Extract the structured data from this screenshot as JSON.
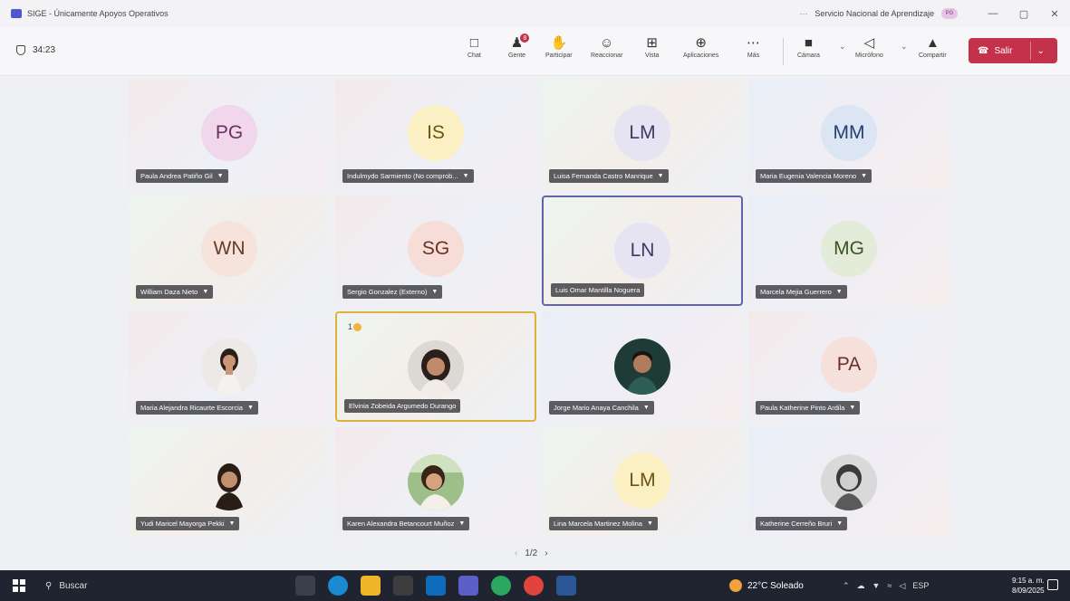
{
  "window": {
    "title": "SIGE - Únicamente Apoyos Operativos",
    "more": "···",
    "org_name": "Servicio Nacional de Aprendizaje",
    "org_badge": "PG",
    "minimize": "—",
    "maximize": "▢",
    "close": "✕"
  },
  "meeting": {
    "timer": "34:23"
  },
  "toolbar": {
    "chat": "Chat",
    "people": "Gente",
    "people_badge": "8",
    "raise": "Participar",
    "react": "Reaccionar",
    "view": "Vista",
    "apps": "Aplicaciones",
    "more": "Más",
    "camera": "Cámara",
    "mic": "Micrófono",
    "share": "Compartir",
    "leave": "Salir"
  },
  "participants": [
    {
      "initials": "PG",
      "name": "Paula Andrea Patiño Gil",
      "avatar_color": "#f1d7ec",
      "text_color": "#6b2f66"
    },
    {
      "initials": "IS",
      "name": "Indulmydo Sarmiento (No comprob...",
      "avatar_color": "#fbf0c4",
      "text_color": "#6a5410"
    },
    {
      "initials": "LM",
      "name": "Luisa Fernanda Castro Manrique",
      "avatar_color": "#e6e3f3",
      "text_color": "#3e3a66"
    },
    {
      "initials": "MM",
      "name": "Maria Eugenia Valencia Moreno",
      "avatar_color": "#dbe5f4",
      "text_color": "#24406b"
    },
    {
      "initials": "WN",
      "name": "William Daza Nieto",
      "avatar_color": "#f6e4dc",
      "text_color": "#6a3a22"
    },
    {
      "initials": "SG",
      "name": "Sergio Gonzalez (Externo)",
      "avatar_color": "#f7ddd8",
      "text_color": "#6e2f24"
    },
    {
      "initials": "LN",
      "name": "Luis Omar Mantilla Noguera",
      "avatar_color": "#e6e3f3",
      "text_color": "#3e3a66"
    },
    {
      "initials": "MG",
      "name": "Marcela Mejia Guerrero",
      "avatar_color": "#e3ecd9",
      "text_color": "#3a5424"
    },
    {
      "initials": "",
      "name": "Maria Alejandra Ricaurte Escorcia"
    },
    {
      "initials": "",
      "name": "Elvinia Zobeida Argumedo Durango",
      "hand_count": "1"
    },
    {
      "initials": "",
      "name": "Jorge Mario Anaya Canchila"
    },
    {
      "initials": "PA",
      "name": "Paula Katherine Pinto Ardila",
      "avatar_color": "#f6e0dc",
      "text_color": "#6b2f2a"
    },
    {
      "initials": "",
      "name": "Yudi Maricel Mayorga Pekki"
    },
    {
      "initials": "",
      "name": "Karen Alexandra Betancourt Muñoz"
    },
    {
      "initials": "LM",
      "name": "Lina Marcela Martinez Molina",
      "avatar_color": "#fbf0c4",
      "text_color": "#6a5410"
    },
    {
      "initials": "",
      "name": "Katherine Cerreño Bruri"
    }
  ],
  "pager": {
    "prev": "‹",
    "label": "1/2",
    "next": "›"
  },
  "taskbar": {
    "search": "Buscar",
    "weather": "22°C Soleado",
    "lang": "ESP",
    "time": "9:15 a. m.",
    "date": "8/09/2025"
  }
}
